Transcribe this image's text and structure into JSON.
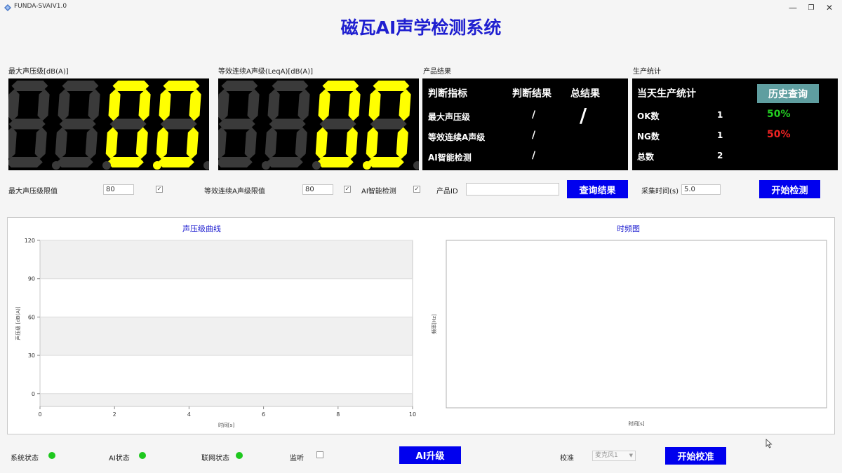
{
  "window": {
    "app_name": "FUNDA-SVAIV1.0",
    "minimize_glyph": "—",
    "restore_glyph": "❐",
    "close_glyph": "✕"
  },
  "title": "磁瓦AI声学检测系统",
  "sections": {
    "max_spl": "最大声压级[dB(A)]",
    "leq": "等效连续A声级(LeqA)[dB(A)]",
    "product_result": "产品结果",
    "production_stats": "生产统计"
  },
  "displays": {
    "max_spl_value": "0.0",
    "leq_value": "0.0",
    "active_color": "#ffff00",
    "inactive_color": "#3a3a3a"
  },
  "result_panel": {
    "headers": [
      "判断指标",
      "判断结果",
      "总结果"
    ],
    "rows": [
      {
        "name": "最大声压级",
        "result": "/"
      },
      {
        "name": "等效连续A声级",
        "result": "/"
      },
      {
        "name": "AI智能检测",
        "result": "/"
      }
    ],
    "total": "/"
  },
  "stats_panel": {
    "title": "当天生产统计",
    "history_button": "历史查询",
    "rows": [
      {
        "name": "OK数",
        "count": "1",
        "pct": "50%",
        "color": "#22cc22"
      },
      {
        "name": "NG数",
        "count": "1",
        "pct": "50%",
        "color": "#ee2222"
      },
      {
        "name": "总数",
        "count": "2",
        "pct": "",
        "color": "#ffffff"
      }
    ]
  },
  "controls": {
    "max_limit_label": "最大声压级限值",
    "max_limit_value": "80",
    "max_limit_checked": "✓",
    "leq_limit_label": "等效连续A声级限值",
    "leq_limit_value": "80",
    "leq_limit_checked": "✓",
    "ai_label": "AI智能检测",
    "ai_checked": "✓",
    "product_id_label": "产品ID",
    "product_id_value": "",
    "query_button": "查询结果",
    "sample_time_label": "采集时间(s)",
    "sample_time_value": "5.0",
    "start_button": "开始检测"
  },
  "chart_data": [
    {
      "type": "line",
      "title": "声压级曲线",
      "xlabel": "时间[s]",
      "ylabel": "声压级 [dB(A)]",
      "xlim": [
        0,
        10
      ],
      "ylim": [
        -10,
        120
      ],
      "x_ticks": [
        "0",
        "2",
        "4",
        "6",
        "8",
        "10"
      ],
      "y_ticks": [
        "120",
        "90",
        "60",
        "30",
        "0"
      ],
      "series": []
    },
    {
      "type": "heatmap",
      "title": "时频图",
      "xlabel": "时间[s]",
      "ylabel": "频率[Hz]",
      "series": []
    }
  ],
  "status": {
    "system": "系统状态",
    "ai": "AI状态",
    "network": "联网状态",
    "monitor": "监听",
    "ai_upgrade_button": "AI升级",
    "calibrate_label": "校准",
    "mic_select": "麦克风1",
    "start_calibrate_button": "开始校准",
    "ok_color": "#1ec81e"
  }
}
